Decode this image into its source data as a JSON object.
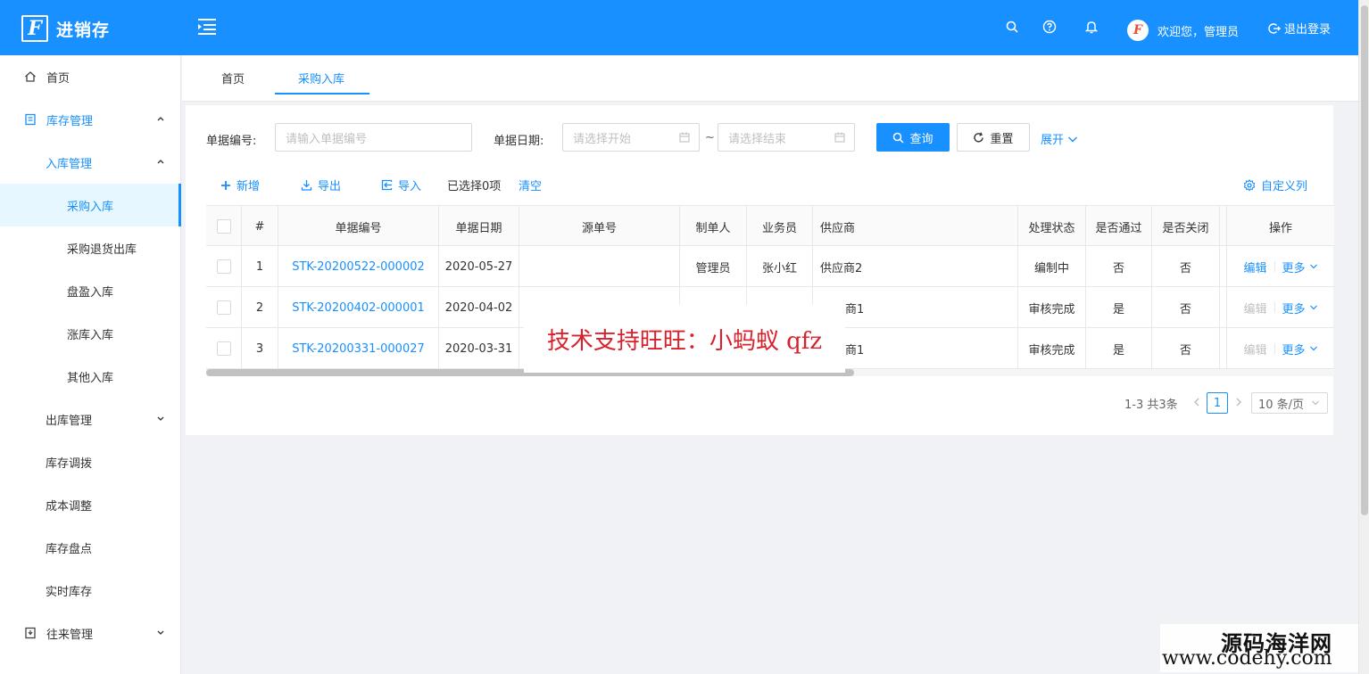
{
  "header": {
    "app_title": "进销存",
    "logo_letter": "F",
    "welcome": "欢迎您，管理员",
    "logout": "退出登录",
    "icons": [
      "search-icon",
      "question-icon",
      "bell-icon"
    ]
  },
  "sidebar": {
    "items": [
      {
        "label": "首页",
        "icon": "home-icon"
      },
      {
        "label": "库存管理",
        "icon": "inventory-icon"
      },
      {
        "label": "入库管理"
      },
      {
        "label": "采购入库"
      },
      {
        "label": "采购退货出库"
      },
      {
        "label": "盘盈入库"
      },
      {
        "label": "涨库入库"
      },
      {
        "label": "其他入库"
      },
      {
        "label": "出库管理"
      },
      {
        "label": "库存调拨"
      },
      {
        "label": "成本调整"
      },
      {
        "label": "库存盘点"
      },
      {
        "label": "实时库存"
      },
      {
        "label": "往来管理",
        "icon": "contacts-icon"
      }
    ]
  },
  "tabs": [
    {
      "label": "首页"
    },
    {
      "label": "采购入库",
      "active": true
    }
  ],
  "search": {
    "bill_no_label": "单据编号:",
    "bill_no_placeholder": "请输入单据编号",
    "date_label": "单据日期:",
    "start_placeholder": "请选择开始",
    "end_placeholder": "请选择结束",
    "tilde": "~",
    "query": "查询",
    "reset": "重置",
    "expand": "展开"
  },
  "toolbar": {
    "add": "新增",
    "export": "导出",
    "import": "导入",
    "selected": "已选择0项",
    "clear": "清空",
    "custom_columns": "自定义列"
  },
  "table": {
    "columns": [
      "#",
      "单据编号",
      "单据日期",
      "源单号",
      "制单人",
      "业务员",
      "供应商",
      "处理状态",
      "是否通过",
      "是否关闭",
      "操作"
    ],
    "rows": [
      {
        "idx": "1",
        "bill_no": "STK-20200522-000002",
        "date": "2020-05-27",
        "source": "",
        "creator": "管理员",
        "sales": "张小红",
        "supplier": "供应商2",
        "status": "编制中",
        "passed": "否",
        "closed": "否",
        "edit": "编辑",
        "edit_enabled": true,
        "more": "更多"
      },
      {
        "idx": "2",
        "bill_no": "STK-20200402-000001",
        "date": "2020-04-02",
        "source": "",
        "creator": "",
        "sales": "",
        "supplier": "商1",
        "status": "审核完成",
        "passed": "是",
        "closed": "否",
        "edit": "编辑",
        "edit_enabled": false,
        "more": "更多"
      },
      {
        "idx": "3",
        "bill_no": "STK-20200331-000027",
        "date": "2020-03-31",
        "source": "",
        "creator": "",
        "sales": "",
        "supplier": "商1",
        "status": "审核完成",
        "passed": "是",
        "closed": "否",
        "edit": "编辑",
        "edit_enabled": false,
        "more": "更多"
      }
    ]
  },
  "pagination": {
    "total": "1-3 共3条",
    "current": "1",
    "page_size": "10 条/页"
  },
  "watermark": {
    "text": "技术支持旺旺：小蚂蚁 qfz",
    "site_name": "源码海洋网",
    "site_url": "www.codehy.com"
  },
  "colors": {
    "primary": "#1890ff",
    "watermark": "#d9212c"
  }
}
